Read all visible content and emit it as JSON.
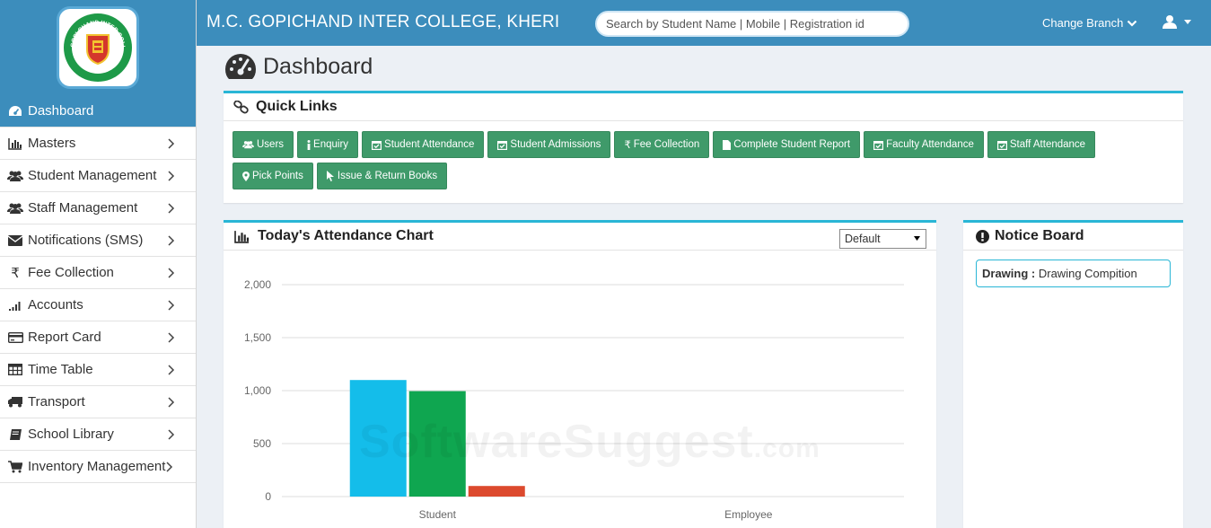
{
  "header": {
    "title": "M.C. GOPICHAND INTER COLLEGE, KHERI",
    "search_placeholder": "Search by Student Name | Mobile | Registration id",
    "branch_label": "Change Branch"
  },
  "logo": {
    "text_top": "M.C. GOPI CHAND INTER COLLEGE",
    "text_bottom": "KHERI, G.B.NAGAR"
  },
  "sidebar": {
    "items": [
      {
        "label": "Dashboard",
        "icon": "dashboard-icon",
        "active": true
      },
      {
        "label": "Masters",
        "icon": "bar-chart-icon"
      },
      {
        "label": "Student Management",
        "icon": "users-icon"
      },
      {
        "label": "Staff Management",
        "icon": "users-icon"
      },
      {
        "label": "Notifications (SMS)",
        "icon": "envelope-icon"
      },
      {
        "label": "Fee Collection",
        "icon": "rupee-icon"
      },
      {
        "label": "Accounts",
        "icon": "signal-icon"
      },
      {
        "label": "Report Card",
        "icon": "credit-card-icon"
      },
      {
        "label": "Time Table",
        "icon": "table-icon"
      },
      {
        "label": "Transport",
        "icon": "truck-icon"
      },
      {
        "label": "School Library",
        "icon": "book-icon"
      },
      {
        "label": "Inventory Management",
        "icon": "cart-icon"
      }
    ]
  },
  "page": {
    "title": "Dashboard"
  },
  "quick_links": {
    "title": "Quick Links",
    "buttons": [
      {
        "label": "Users",
        "icon": "users-icon"
      },
      {
        "label": "Enquiry",
        "icon": "info-icon"
      },
      {
        "label": "Student Attendance",
        "icon": "calendar-check-icon"
      },
      {
        "label": "Student Admissions",
        "icon": "calendar-check-icon"
      },
      {
        "label": "Fee Collection",
        "icon": "rupee-icon"
      },
      {
        "label": "Complete Student Report",
        "icon": "file-icon"
      },
      {
        "label": "Faculty Attendance",
        "icon": "calendar-check-icon"
      },
      {
        "label": "Staff Attendance",
        "icon": "calendar-check-icon"
      },
      {
        "label": "Pick Points",
        "icon": "map-marker-icon"
      },
      {
        "label": "Issue & Return Books",
        "icon": "pointer-icon"
      }
    ]
  },
  "attendance": {
    "title": "Today's Attendance Chart",
    "select_value": "Default"
  },
  "notice_board": {
    "title": "Notice Board",
    "notices": [
      {
        "label": "Drawing :",
        "text": "Drawing Compition"
      }
    ]
  },
  "chart_data": {
    "type": "bar",
    "categories": [
      "Student",
      "Employee"
    ],
    "series": [
      {
        "values": [
          1100,
          0
        ],
        "color": "#14bdea"
      },
      {
        "values": [
          995,
          0
        ],
        "color": "#0fa650"
      },
      {
        "values": [
          100,
          0
        ],
        "color": "#dc4a2e"
      }
    ],
    "ylim": [
      0,
      2000
    ],
    "yticks": [
      "0",
      "500",
      "1,000",
      "1,500",
      "2,000"
    ],
    "grid": true
  },
  "watermark": {
    "text": "SoftwareSuggest",
    "suffix": ".com"
  }
}
